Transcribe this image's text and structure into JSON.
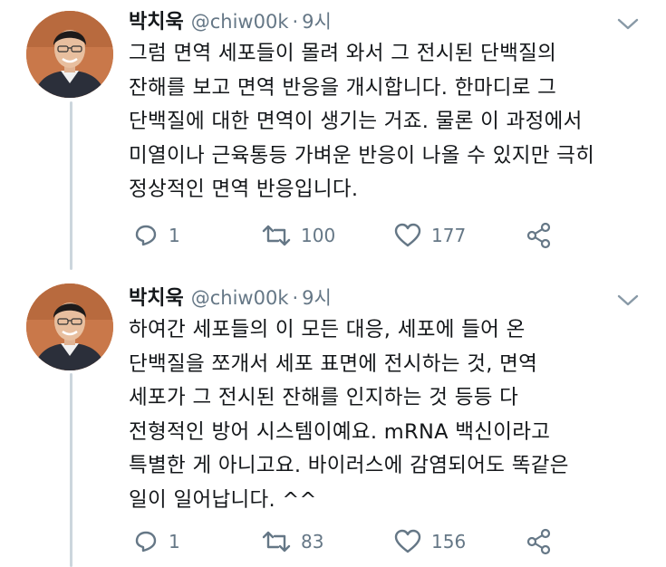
{
  "tweets": [
    {
      "author_name": "박치욱",
      "handle": "@chiw00k",
      "separator": "·",
      "time": "9시",
      "lines": [
        "그럼 면역 세포들이 몰려 와서 그 전시된 단백질의",
        "잔해를 보고 면역 반응을 개시합니다. 한마디로 그",
        "단백질에 대한 면역이 생기는 거죠. 물론 이 과정에서",
        "미열이나 근육통등 가벼운 반응이 나올 수 있지만 극히",
        "정상적인 면역 반응입니다."
      ],
      "replies": "1",
      "retweets": "100",
      "likes": "177"
    },
    {
      "author_name": "박치욱",
      "handle": "@chiw00k",
      "separator": "·",
      "time": "9시",
      "lines": [
        "하여간 세포들의 이 모든 대응, 세포에 들어 온",
        "단백질을 쪼개서 세포 표면에 전시하는 것, 면역",
        "세포가 그 전시된 잔해를 인지하는 것 등등 다",
        "전형적인 방어 시스템이예요. mRNA 백신이라고",
        "특별한 게 아니고요. 바이러스에 감염되어도 똑같은",
        "일이 일어납니다. ^^"
      ],
      "replies": "1",
      "retweets": "83",
      "likes": "156"
    }
  ],
  "icons": {
    "reply": "reply-icon",
    "retweet": "retweet-icon",
    "like": "heart-icon",
    "share": "share-icon",
    "menu": "chevron-down-icon"
  },
  "colors": {
    "text": "#14171a",
    "muted": "#657786",
    "thread_line": "#ccd6dd"
  }
}
